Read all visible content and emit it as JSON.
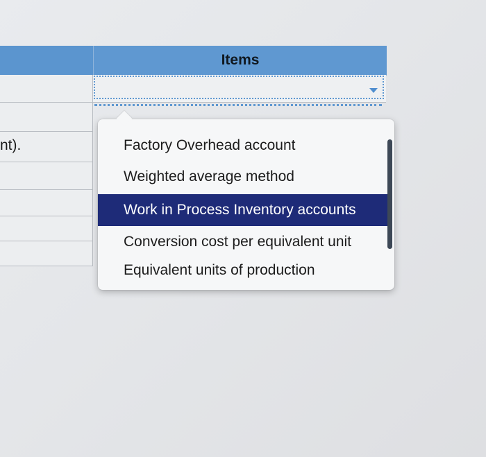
{
  "table": {
    "header_label": "Items",
    "left_fragment": "nt).",
    "selected_value": ""
  },
  "dropdown": {
    "options": [
      "Factory Overhead account",
      "Weighted average method",
      "Work in Process Inventory accounts",
      "Conversion cost per equivalent unit",
      "Equivalent units of production"
    ],
    "selected_index": 2
  },
  "colors": {
    "header_blue": "#5f98d1",
    "selected_bg": "#1e2b78"
  }
}
